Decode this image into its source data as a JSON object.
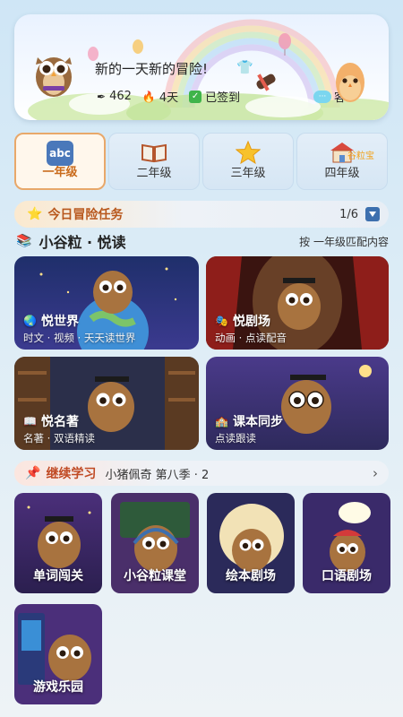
{
  "banner": {
    "title": "新的一天新的冒险!",
    "stats": {
      "points": "462",
      "streak": "4天",
      "signed": "已签到"
    },
    "service_label": "客",
    "service_bubble": "···"
  },
  "grades": [
    {
      "label": "一年级",
      "icon": "abc-block-icon",
      "icon_text": "abc",
      "active": true
    },
    {
      "label": "二年级",
      "icon": "open-book-icon",
      "active": false
    },
    {
      "label": "三年级",
      "icon": "star-icon",
      "active": false
    },
    {
      "label": "四年级",
      "icon": "school-house-icon",
      "active": false
    }
  ],
  "school_badge": "谷粒宝",
  "daily_task": {
    "title": "今日冒险任务",
    "progress": "1/6"
  },
  "section": {
    "title": "小谷粒 · 悦读",
    "match_text": "按 一年级匹配内容"
  },
  "cards": [
    {
      "title": "悦世界",
      "subtitle": "时文 · 视频 · 天天读世界",
      "icon": "globe-icon"
    },
    {
      "title": "悦剧场",
      "subtitle": "动画 · 点读配音",
      "icon": "theater-mask-icon"
    },
    {
      "title": "悦名著",
      "subtitle": "名著 · 双语精读",
      "icon": "book-icon"
    },
    {
      "title": "课本同步",
      "subtitle": "点读跟读",
      "icon": "school-icon"
    }
  ],
  "continue": {
    "title": "继续学习",
    "episode": "小猪佩奇 第八季 · 2"
  },
  "tiles": [
    {
      "label": "单词闯关"
    },
    {
      "label": "小谷粒课堂"
    },
    {
      "label": "绘本剧场"
    },
    {
      "label": "口语剧场"
    },
    {
      "label": "游戏乐园"
    }
  ],
  "colors": {
    "accent_orange": "#c96a1a",
    "task_title": "#b8571c",
    "continue_title": "#c04a24",
    "dropdown_blue": "#3d6fae"
  }
}
